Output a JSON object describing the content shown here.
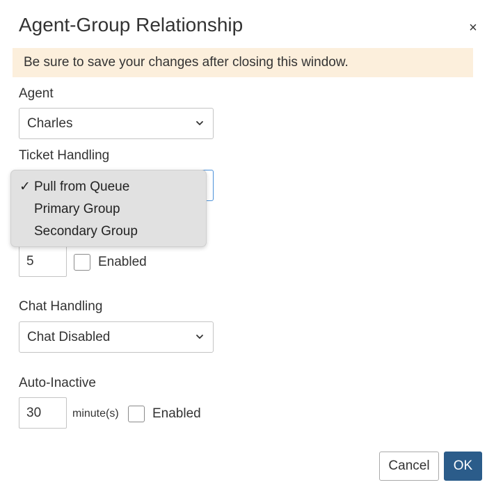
{
  "dialog": {
    "title": "Agent-Group Relationship",
    "close_glyph": "×",
    "notice": "Be sure to save your changes after closing this window."
  },
  "agent": {
    "label": "Agent",
    "value": "Charles"
  },
  "ticket_handling": {
    "label": "Ticket Handling",
    "options": [
      {
        "label": "Pull from Queue",
        "selected": true
      },
      {
        "label": "Primary Group",
        "selected": false
      },
      {
        "label": "Secondary Group",
        "selected": false
      }
    ],
    "check_glyph": "✓"
  },
  "limit": {
    "value": "5",
    "enabled_label": "Enabled",
    "enabled": false
  },
  "chat_handling": {
    "label": "Chat Handling",
    "value": "Chat Disabled"
  },
  "auto_inactive": {
    "label": "Auto-Inactive",
    "value": "30",
    "unit": "minute(s)",
    "enabled_label": "Enabled",
    "enabled": false
  },
  "footer": {
    "cancel_label": "Cancel",
    "ok_label": "OK"
  },
  "icons": {
    "close": "close-icon",
    "chevron": "chevron-down-icon",
    "check": "checkmark-icon"
  },
  "colors": {
    "notice_bg": "#fcefdc",
    "primary": "#2b5c8a",
    "focus": "#4a90d9",
    "dropdown_bg": "#e1e1e1"
  }
}
